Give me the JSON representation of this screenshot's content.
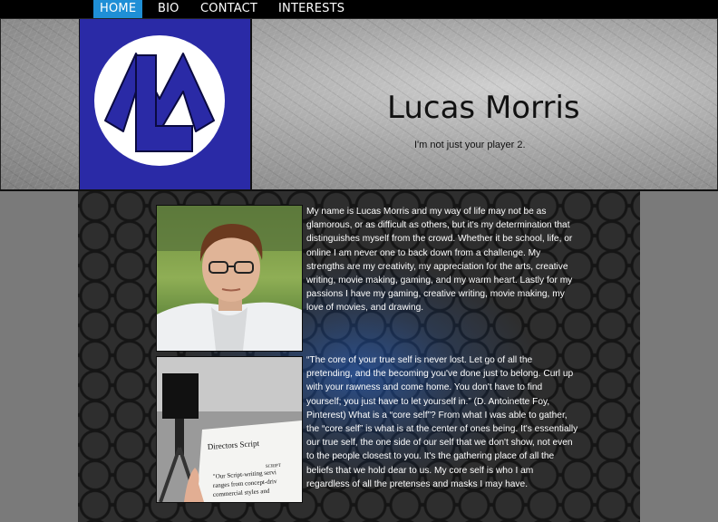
{
  "nav": {
    "items": [
      {
        "label": "HOME",
        "active": true
      },
      {
        "label": "BIO",
        "active": false
      },
      {
        "label": "CONTACT",
        "active": false
      },
      {
        "label": "INTERESTS",
        "active": false
      }
    ],
    "active_color": "#1f8fd6"
  },
  "header": {
    "name": "Lucas Morris",
    "tagline": "I'm not just your player 2.",
    "logo_color": "#2a2aa6"
  },
  "main": {
    "bio_text": "My name is Lucas Morris and my way of life may not be as glamorous, or as difficult as others, but it's my determination that distinguishes myself from the crowd. Whether it be school, life, or online I am never one to back down from a challenge. My strengths are my creativity, my appreciation for the arts, creative writing, movie making, gaming, and my warm heart. Lastly for my passions I have my gaming, creative writing, movie making, my love of movies, and drawing.",
    "quote_text": "“The core of your true self is never lost. Let go of all the pretending, and the becoming you've done just to belong. Curl up with your rawness and come home. You don't have to find yourself; you just have to let yourself in.” (D. Antoinette Foy, Pinterest) What is a “core self”? From what I was able to gather, the “core self” is what is at the center of ones being. It's essentially our true self, the one side of our self that we don't show, not even to the people closest to you. It's the gathering place of all the beliefs that we hold dear to us. My core self is who I am regardless of all the pretenses and masks I may have.",
    "script_image": {
      "heading": "Directors Script",
      "label": "SCRIPT",
      "line1": "\"Our Script-writing servi",
      "line2": "ranges from concept-driv",
      "line3": "commercial styles and"
    }
  }
}
